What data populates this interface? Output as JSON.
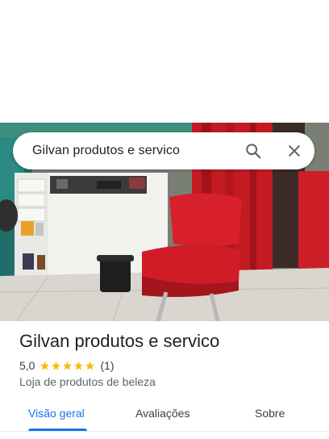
{
  "search": {
    "query": "Gilvan produtos e servico",
    "search_icon": "search-icon",
    "close_icon": "close-icon"
  },
  "place": {
    "name": "Gilvan produtos e servico",
    "rating": "5,0",
    "stars": 5,
    "review_count": "(1)",
    "category": "Loja de produtos de beleza"
  },
  "tabs": [
    {
      "label": "Visão geral",
      "active": true
    },
    {
      "label": "Avaliações",
      "active": false
    },
    {
      "label": "Sobre",
      "active": false
    }
  ],
  "colors": {
    "accent": "#1a73e8",
    "star": "#fbbc04",
    "chair_red": "#d8202c"
  }
}
